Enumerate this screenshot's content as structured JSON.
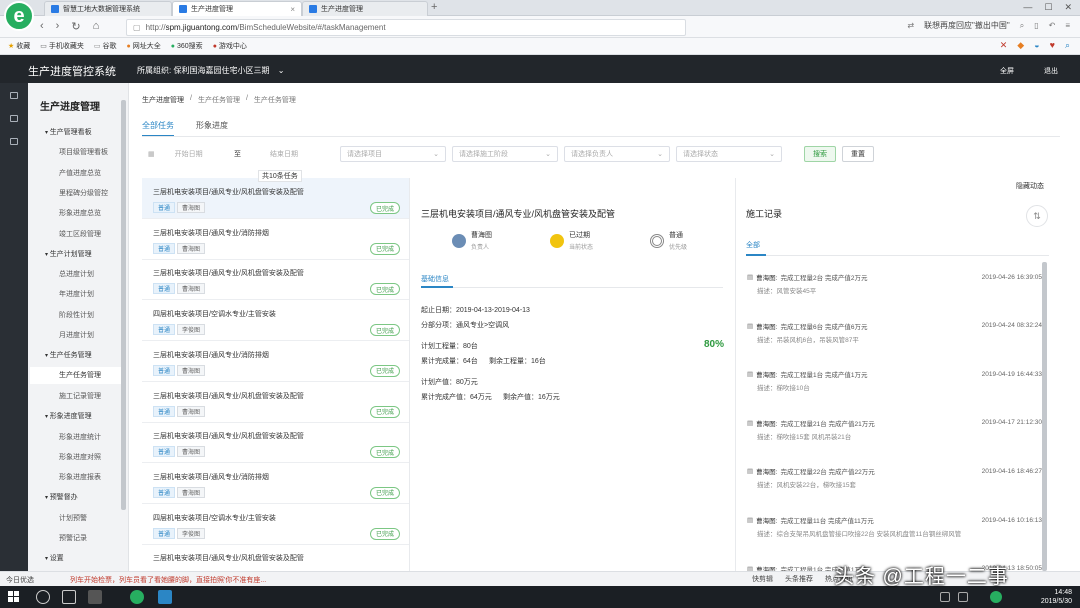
{
  "browser": {
    "tabs": [
      {
        "title": "智慧工地大数据管理系统"
      },
      {
        "title": "生产进度管理"
      },
      {
        "title": "生产进度管理"
      }
    ],
    "url_host": "spm.jiguantong.com",
    "url_path": "/BimScheduleWebsite/#/taskManagement",
    "url_prefix": "http://",
    "search_hint": "联想再度回应\"撤出中国\"",
    "bookmarks": [
      "收藏",
      "手机收藏夹",
      "谷歌",
      "网址大全",
      "360搜索",
      "游戏中心"
    ]
  },
  "app": {
    "title": "生产进度管控系统",
    "org_label": "所属组织:",
    "org_value": "保利国海嘉园住宅小区三期",
    "fullscreen": "全屏",
    "logout": "退出"
  },
  "sidebar": {
    "title": "生产进度管理",
    "items": [
      {
        "label": "生产管理看板",
        "group": true
      },
      {
        "label": "项目级管理看板"
      },
      {
        "label": "产值进度总览"
      },
      {
        "label": "里程碑分级管控"
      },
      {
        "label": "形象进度总览"
      },
      {
        "label": "竣工区段管理"
      },
      {
        "label": "生产计划管理",
        "group": true
      },
      {
        "label": "总进度计划"
      },
      {
        "label": "年进度计划"
      },
      {
        "label": "阶段性计划"
      },
      {
        "label": "月进度计划"
      },
      {
        "label": "生产任务管理",
        "group": true
      },
      {
        "label": "生产任务管理",
        "active": true
      },
      {
        "label": "施工记录管理"
      },
      {
        "label": "形象进度管理",
        "group": true
      },
      {
        "label": "形象进度统计"
      },
      {
        "label": "形象进度对照"
      },
      {
        "label": "形象进度报表"
      },
      {
        "label": "预警督办",
        "group": true
      },
      {
        "label": "计划预警"
      },
      {
        "label": "预警记录"
      },
      {
        "label": "设置",
        "group": true
      }
    ]
  },
  "breadcrumb": [
    "生产进度管理",
    "生产任务管理",
    "生产任务管理"
  ],
  "tabs": [
    {
      "label": "全部任务",
      "active": true
    },
    {
      "label": "形象进度"
    }
  ],
  "filters": {
    "start_date": "开始日期",
    "to": "至",
    "end_date": "结束日期",
    "project": "请选择项目",
    "stage": "请选择施工阶段",
    "owner": "请选择负责人",
    "status": "请选择状态",
    "search": "搜索",
    "reset": "重置"
  },
  "list": {
    "count_label": "共10条任务",
    "items": [
      {
        "title": "三层机电安装项目/通风专业/风机盘管安装及配管",
        "type": "普通",
        "person": "曹海图",
        "status": "已完成",
        "selected": true
      },
      {
        "title": "三层机电安装项目/通风专业/消防排烟",
        "type": "普通",
        "person": "曹海图",
        "status": "已完成"
      },
      {
        "title": "三层机电安装项目/通风专业/风机盘管安装及配管",
        "type": "普通",
        "person": "曹海图",
        "status": "已完成"
      },
      {
        "title": "四层机电安装项目/空调水专业/主管安装",
        "type": "普通",
        "person": "李俊图",
        "status": "已完成"
      },
      {
        "title": "三层机电安装项目/通风专业/消防排烟",
        "type": "普通",
        "person": "曹海图",
        "status": "已完成"
      },
      {
        "title": "三层机电安装项目/通风专业/风机盘管安装及配管",
        "type": "普通",
        "person": "曹海图",
        "status": "已完成"
      },
      {
        "title": "三层机电安装项目/通风专业/风机盘管安装及配管",
        "type": "普通",
        "person": "曹海图",
        "status": "已完成"
      },
      {
        "title": "三层机电安装项目/通风专业/消防排烟",
        "type": "普通",
        "person": "曹海图",
        "status": "已完成"
      },
      {
        "title": "四层机电安装项目/空调水专业/主管安装",
        "type": "普通",
        "person": "李俊图",
        "status": "已完成"
      },
      {
        "title": "三层机电安装项目/通风专业/风机盘管安装及配管",
        "type": "",
        "person": "",
        "status": ""
      }
    ]
  },
  "detail": {
    "title": "三层机电安装项目/通风专业/风机盘管安装及配管",
    "owner_name": "曹海图",
    "owner_label": "负责人",
    "state_value": "已过期",
    "state_label": "当前状态",
    "priority_value": "普通",
    "priority_label": "优先级",
    "basic_tab": "基础信息",
    "date_range": "起止日期：2019-04-13-2019-04-13",
    "category": "分部分项：通风专业>空调风",
    "planned_qty": "计划工程量：80台",
    "percent": "80%",
    "done_qty": "累计完成量：64台",
    "remain_qty": "剩余工程量：16台",
    "planned_value": "计划产值：80万元",
    "done_value": "累计完成产值：64万元",
    "remain_value": "剩余产值：16万元"
  },
  "logs": {
    "title": "施工记录",
    "hide_active": "隐藏动态",
    "all_tab": "全部",
    "items": [
      {
        "who": "曹海图:",
        "text": "完成工程量2台 完成产值2万元",
        "time": "2019-04-26 16:39:05",
        "desc": "描述：风管安装45平"
      },
      {
        "who": "曹海图:",
        "text": "完成工程量6台 完成产值6万元",
        "time": "2019-04-24 08:32:24",
        "desc": "描述：吊装风机6台，吊装风管87平"
      },
      {
        "who": "曹海图:",
        "text": "完成工程量1台 完成产值1万元",
        "time": "2019-04-19 16:44:33",
        "desc": "描述：梯吹接10台"
      },
      {
        "who": "曹海图:",
        "text": "完成工程量21台 完成产值21万元",
        "time": "2019-04-17 21:12:30",
        "desc": "描述：梯吹接15套 风机吊装21台"
      },
      {
        "who": "曹海图:",
        "text": "完成工程量22台 完成产值22万元",
        "time": "2019-04-16 18:46:27",
        "desc": "描述：风机安装22台，梯吹接15套"
      },
      {
        "who": "曹海图:",
        "text": "完成工程量11台 完成产值11万元",
        "time": "2019-04-16 10:16:13",
        "desc": "描述：综合支架吊风机盘管接口吹接22台 安装风机盘管11台钢丝绑风管"
      },
      {
        "who": "曹海图:",
        "text": "完成工程量1台 完成产值1万元",
        "time": "2019-04-13 18:50:05",
        "desc": "描述：综合支架吊风机盘管"
      }
    ]
  },
  "statusbar": {
    "left": "今日优选",
    "news": "列车开始检票，列车员看了看她腰的脚，直接拍照'你不准有座...",
    "right": [
      "快剪辑",
      "头条推荐",
      "热点资讯"
    ]
  },
  "taskbar": {
    "time": "14:48",
    "date": "2019/5/30"
  },
  "watermark": "头条 @工程一二事"
}
